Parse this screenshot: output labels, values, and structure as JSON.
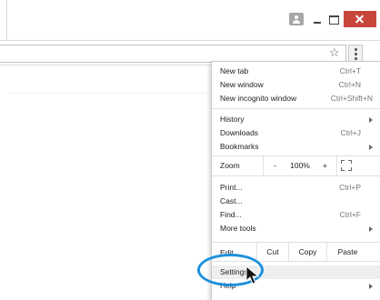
{
  "window": {
    "controls": [
      "user-icon",
      "minimize-icon",
      "maximize-icon",
      "close-icon"
    ],
    "close_color": "#c7463c"
  },
  "toolbar": {
    "address_value": "",
    "bookmark_icon": "star-icon",
    "menu_icon": "three-dot-menu-icon"
  },
  "menu": {
    "group1": [
      {
        "label": "New tab",
        "shortcut": "Ctrl+T"
      },
      {
        "label": "New window",
        "shortcut": "Ctrl+N"
      },
      {
        "label": "New incognito window",
        "shortcut": "Ctrl+Shift+N"
      }
    ],
    "group2": [
      {
        "label": "History",
        "shortcut": ""
      },
      {
        "label": "Downloads",
        "shortcut": "Ctrl+J"
      },
      {
        "label": "Bookmarks",
        "shortcut": ""
      }
    ],
    "zoom": {
      "label": "Zoom",
      "minus": "-",
      "value": "100%",
      "plus": "+"
    },
    "group3": [
      {
        "label": "Print...",
        "shortcut": "Ctrl+P"
      },
      {
        "label": "Cast...",
        "shortcut": ""
      },
      {
        "label": "Find...",
        "shortcut": "Ctrl+F"
      },
      {
        "label": "More tools",
        "shortcut": ""
      }
    ],
    "edit": {
      "label": "Edit",
      "cut": "Cut",
      "copy": "Copy",
      "paste": "Paste"
    },
    "group4": [
      {
        "label": "Settings",
        "shortcut": ""
      },
      {
        "label": "Help",
        "shortcut": ""
      }
    ],
    "highlight_color": "#1e90dd"
  }
}
